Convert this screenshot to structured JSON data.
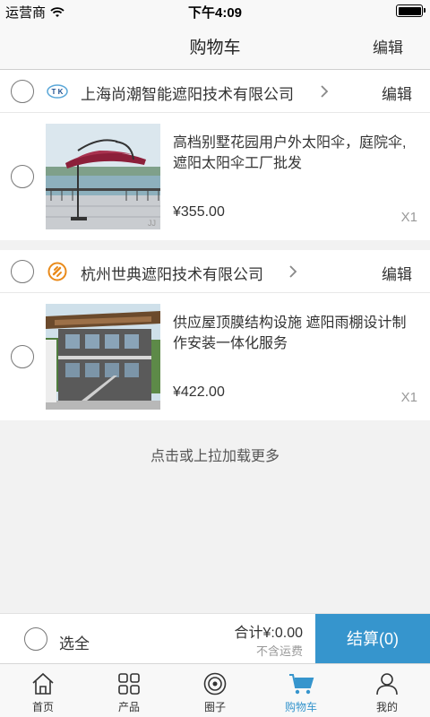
{
  "status_bar": {
    "carrier": "运营商",
    "time": "下午4:09",
    "wifi_icon": "wifi-icon",
    "battery_icon": "battery-icon"
  },
  "nav": {
    "title": "购物车",
    "edit": "编辑"
  },
  "shops": [
    {
      "name": "上海尚潮智能遮阳技术有限公司",
      "edit": "编辑",
      "logo_icon": "shop-logo-tk",
      "items": [
        {
          "description": "高档别墅花园用户外太阳伞，庭院伞,遮阳太阳伞工厂批发",
          "price": "¥355.00",
          "quantity": "X1",
          "image": "patio-umbrella-photo"
        }
      ]
    },
    {
      "name": "杭州世典遮阳技术有限公司",
      "edit": "编辑",
      "logo_icon": "shop-logo-orange",
      "items": [
        {
          "description": "供应屋顶膜结构设施 遮阳雨棚设计制作安装一体化服务",
          "price": "¥422.00",
          "quantity": "X1",
          "image": "building-canopy-photo"
        }
      ]
    }
  ],
  "load_more": "点击或上拉加载更多",
  "checkout": {
    "select_all": "选全",
    "total": "合计¥:0.00",
    "shipping_note": "不含运费",
    "button": "结算(0)"
  },
  "tabs": [
    {
      "label": "首页",
      "icon": "home-icon",
      "active": false
    },
    {
      "label": "产品",
      "icon": "grid-icon",
      "active": false
    },
    {
      "label": "圈子",
      "icon": "circle-icon",
      "active": false
    },
    {
      "label": "购物车",
      "icon": "cart-icon",
      "active": true
    },
    {
      "label": "我的",
      "icon": "user-icon",
      "active": false
    }
  ],
  "colors": {
    "accent": "#3695cd",
    "background": "#f2f2f2"
  }
}
